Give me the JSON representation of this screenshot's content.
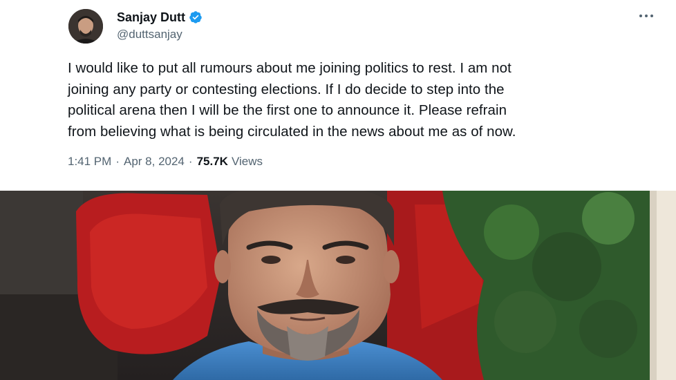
{
  "tweet": {
    "author": {
      "display_name": "Sanjay Dutt",
      "handle": "@duttsanjay",
      "verified": true
    },
    "text": "I would like to put all rumours about me joining politics to rest. I am not\njoining any party or contesting elections. If I do decide to step into the\npolitical arena then I will be the first one to announce it.  Please refrain\nfrom believing what is being circulated in the news about me as of now.",
    "time": "1:41 PM",
    "separator": "·",
    "date": "Apr 8, 2024",
    "views_count": "75.7K",
    "views_label": "Views",
    "more_icon": "more-horizontal-icon"
  },
  "photo": {
    "subject": "portrait-photo",
    "colors": {
      "background_red": "#b81d1f",
      "background_green": "#2f5a2c",
      "shirt_blue": "#3f7fc0"
    }
  },
  "colors": {
    "text_primary": "#0f1419",
    "text_secondary": "#536471",
    "verified_blue": "#1d9bf0"
  }
}
